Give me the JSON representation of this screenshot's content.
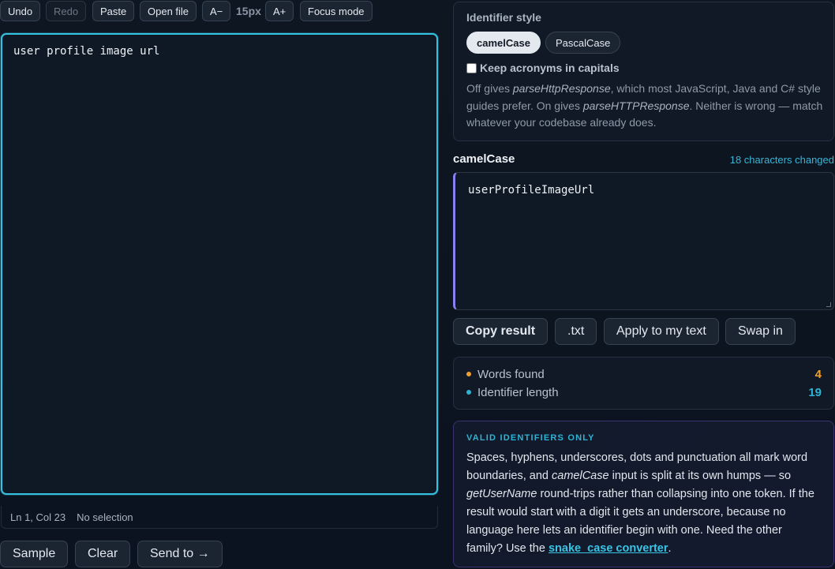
{
  "toolbar": {
    "undo": "Undo",
    "redo": "Redo",
    "paste": "Paste",
    "open_file": "Open file",
    "font_down": "A−",
    "font_size": "15px",
    "font_up": "A+",
    "focus_mode": "Focus mode"
  },
  "editor": {
    "text": "user profile image url",
    "status": {
      "position": "Ln 1, Col 23",
      "selection": "No selection"
    }
  },
  "bottom_buttons": {
    "sample": "Sample",
    "clear": "Clear",
    "send_to": "Send to →"
  },
  "style_panel": {
    "title": "Identifier style",
    "options": [
      "camelCase",
      "PascalCase"
    ],
    "selected": "camelCase",
    "acronyms_label": "Keep acronyms in capitals",
    "acronyms_checked": false,
    "help": {
      "p1": "Off gives ",
      "ex1": "parseHttpResponse",
      "p2": ", which most JavaScript, Java and C# style guides prefer. On gives ",
      "ex2": "parseHTTPResponse",
      "p3": ". Neither is wrong — match whatever your codebase already does."
    }
  },
  "output": {
    "label": "camelCase",
    "meta": "18 characters changed",
    "text": "userProfileImageUrl"
  },
  "actions": {
    "copy": "Copy result",
    "txt": ".txt",
    "apply": "Apply to my text",
    "swap": "Swap in"
  },
  "stats": [
    {
      "label": "Words found",
      "value": "4",
      "color": "#f0a030"
    },
    {
      "label": "Identifier length",
      "value": "19",
      "color": "#2fb3d3"
    }
  ],
  "note": {
    "title": "VALID IDENTIFIERS ONLY",
    "t1": "Spaces, hyphens, underscores, dots and punctuation all mark word boundaries, and ",
    "i1": "camelCase",
    "t2": " input is split at its own humps — so ",
    "i2": "getUserName",
    "t3": " round-trips rather than collapsing into one token. If the result would start with a digit it gets an underscore, because no language here lets an identifier begin with one. Need the other family? Use the ",
    "link": "snake_case converter",
    "t4": "."
  }
}
